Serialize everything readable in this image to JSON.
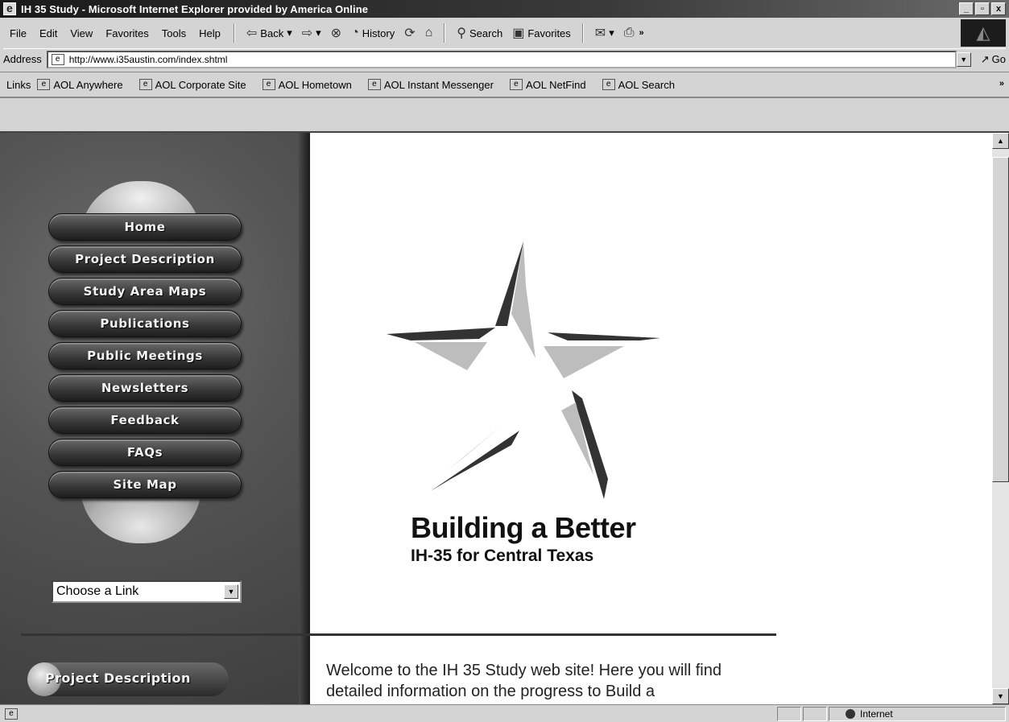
{
  "window": {
    "title": "IH 35 Study - Microsoft Internet Explorer provided by America Online",
    "min": "_",
    "max": "▫",
    "close": "x"
  },
  "menu": {
    "file": "File",
    "edit": "Edit",
    "view": "View",
    "favorites": "Favorites",
    "tools": "Tools",
    "help": "Help"
  },
  "toolbar": {
    "back": "Back",
    "history": "History",
    "search": "Search",
    "favorites": "Favorites",
    "chevron": "»"
  },
  "address": {
    "label": "Address",
    "url": "http://www.i35austin.com/index.shtml",
    "go": "Go"
  },
  "links": {
    "label": "Links",
    "items": [
      "AOL Anywhere",
      "AOL Corporate Site",
      "AOL Hometown",
      "AOL Instant Messenger",
      "AOL NetFind",
      "AOL Search"
    ],
    "chevron": "»"
  },
  "nav": {
    "items": [
      "Home",
      "Project Description",
      "Study Area Maps",
      "Publications",
      "Public Meetings",
      "Newsletters",
      "Feedback",
      "FAQs",
      "Site Map"
    ],
    "select_value": "Choose a Link",
    "section_pill": "Project Description"
  },
  "main": {
    "logo_title": "Building a Better",
    "logo_subtitle": "IH-35 for Central Texas",
    "welcome": "Welcome to the IH 35 Study web site! Here you will find detailed information on the progress to Build a"
  },
  "status": {
    "zone": "Internet"
  }
}
